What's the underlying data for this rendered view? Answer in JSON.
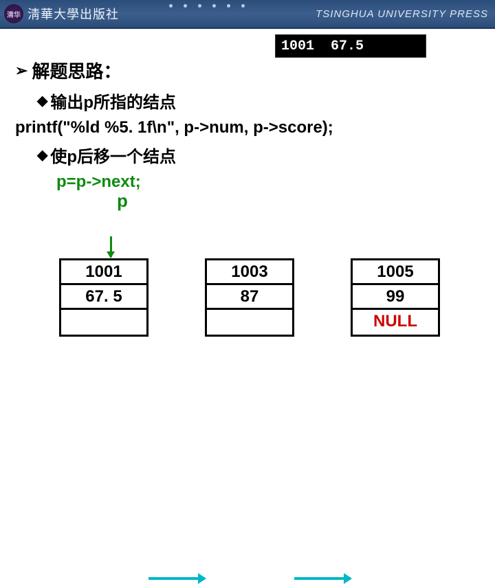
{
  "header": {
    "logo_cn": "淸華大學出版社",
    "press_en": "TSINGHUA UNIVERSITY PRESS"
  },
  "inset": {
    "v1": "1001",
    "v2": "67.5"
  },
  "lines": {
    "h1": "解题思路：",
    "h2a": "输出p所指的结点",
    "code1": "printf(\"%ld %5. 1f\\n\", p->num, p->score);",
    "h2b": "使p后移一个结点",
    "code2": "p=p->next;",
    "p_label": "p"
  },
  "nodes": [
    {
      "num": "1001",
      "score": "67. 5",
      "next": ""
    },
    {
      "num": "1003",
      "score": "87",
      "next": ""
    },
    {
      "num": "1005",
      "score": "99",
      "next": "NULL"
    }
  ]
}
